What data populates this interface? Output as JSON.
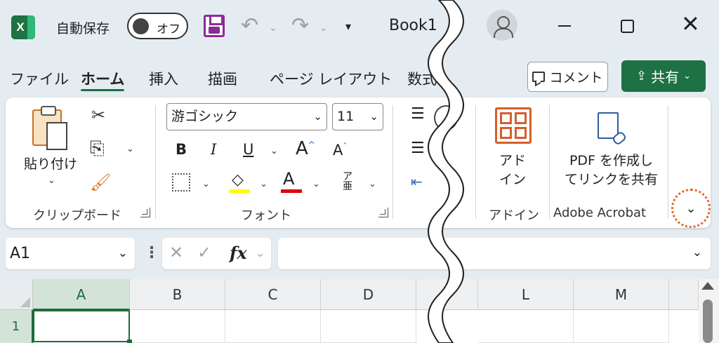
{
  "titlebar": {
    "app_icon_letter": "X",
    "autosave_label": "自動保存",
    "autosave_state": "オフ",
    "file_title": "Book1",
    "qa_icons": [
      "undo-icon",
      "redo-icon",
      "customize-icon"
    ]
  },
  "tabs": [
    {
      "label": "ファイル"
    },
    {
      "label": "ホーム",
      "active": true
    },
    {
      "label": "挿入"
    },
    {
      "label": "描画"
    },
    {
      "label": "ページ レイアウト"
    },
    {
      "label": "数式"
    }
  ],
  "actions": {
    "comment_label": "コメント",
    "share_label": "共有",
    "share_color": "#1e7145"
  },
  "ribbon": {
    "clipboard": {
      "paste_label": "貼り付け",
      "group_label": "クリップボード"
    },
    "font": {
      "font_name": "游ゴシック",
      "font_size": "11",
      "bold": "B",
      "italic": "I",
      "underline": "U",
      "grow": "A",
      "shrink": "A",
      "fill_color": "#ffff00",
      "font_color": "#e00000",
      "phonetic": "ア",
      "group_label": "フォント"
    },
    "addin": {
      "label_line1": "アド",
      "label_line2": "イン",
      "group_label": "アドイン"
    },
    "acrobat": {
      "label_line1": "PDF を作成し",
      "label_line2": "てリンクを共有",
      "group_label": "Adobe Acrobat"
    }
  },
  "formula_bar": {
    "name_box": "A1",
    "fx": "fx",
    "formula": ""
  },
  "grid": {
    "columns": [
      "A",
      "B",
      "C",
      "D",
      "L",
      "M"
    ],
    "rows": [
      "1"
    ],
    "selected_cell": "A1"
  }
}
